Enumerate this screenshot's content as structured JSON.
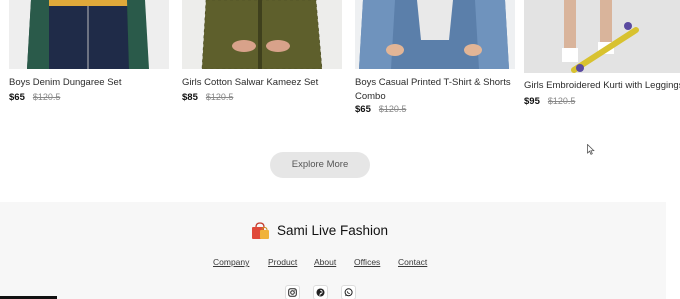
{
  "products": [
    {
      "name": "Boys Denim Dungaree Set",
      "price": "$65",
      "old_price": "$120.5"
    },
    {
      "name": "Girls Cotton Salwar Kameez Set",
      "price": "$85",
      "old_price": "$120.5"
    },
    {
      "name_line1": "Boys Casual Printed T-Shirt & Shorts",
      "name_line2": "Combo",
      "price": "$65",
      "old_price": "$120.5"
    },
    {
      "name": "Girls Embroidered Kurti with Leggings",
      "price": "$95",
      "old_price": "$120.5"
    }
  ],
  "explore_label": "Explore More",
  "footer": {
    "brand": "Sami Live Fashion",
    "links": [
      "Company",
      "Product",
      "About",
      "Offices",
      "Contact"
    ],
    "social_icons": [
      "instagram-icon",
      "pinterest-icon",
      "whatsapp-icon"
    ]
  },
  "colors": {
    "button_bg": "#e6e6e6",
    "footer_bg": "#f7f7f7",
    "brand_logo": "#e0493a"
  }
}
